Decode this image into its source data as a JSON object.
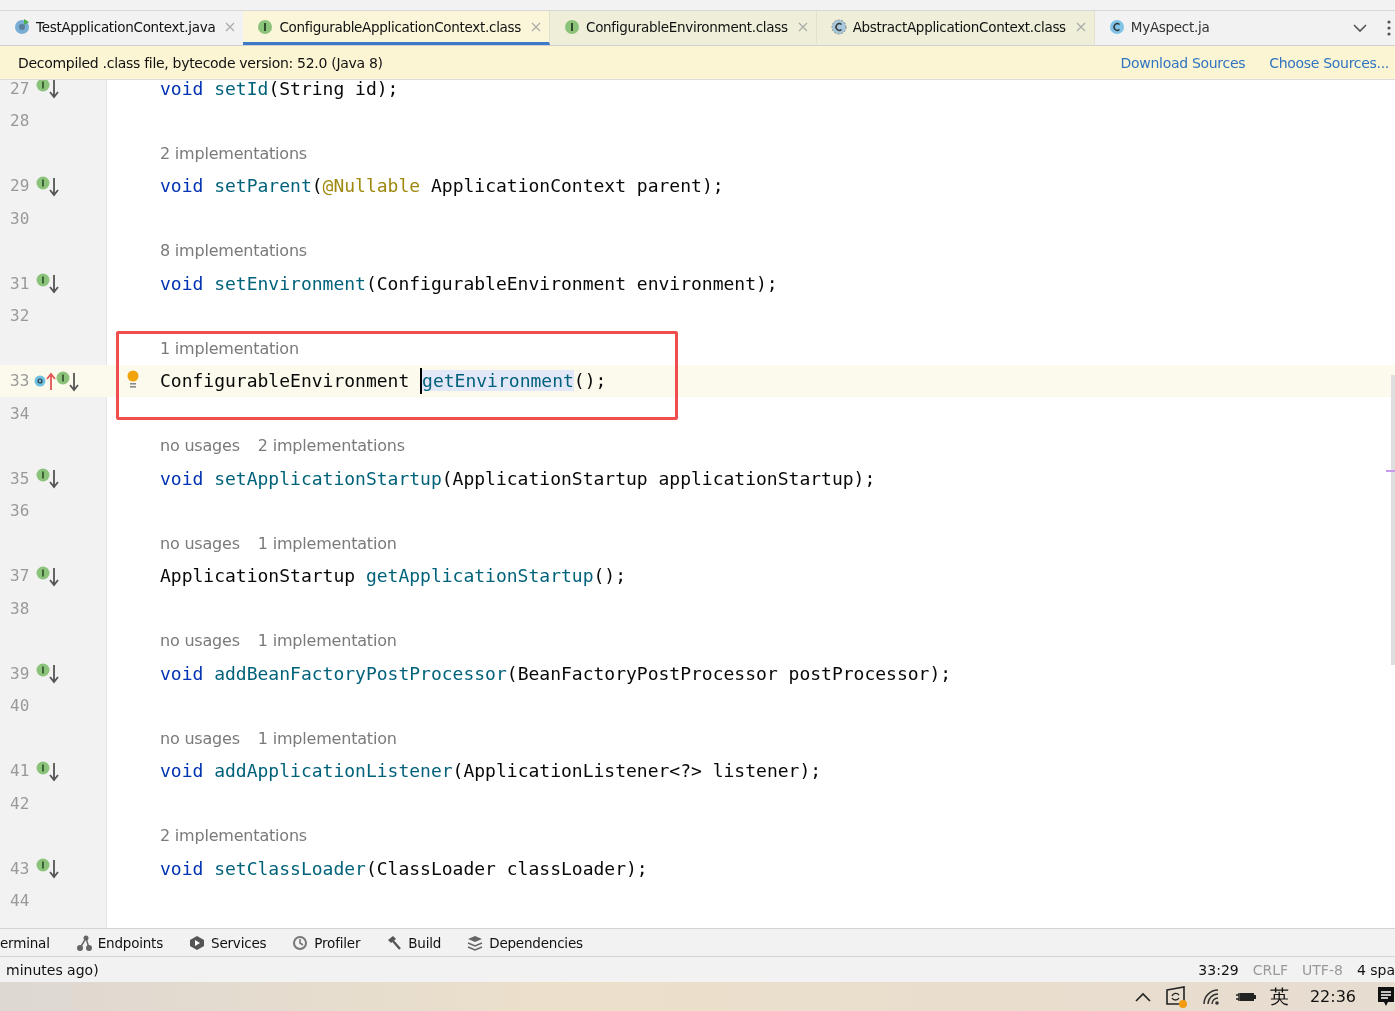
{
  "tabs": [
    {
      "label": "TestApplicationContext.java",
      "kind": "test",
      "selected": false
    },
    {
      "label": "ConfigurableApplicationContext.class",
      "kind": "interface",
      "selected": true
    },
    {
      "label": "ConfigurableEnvironment.class",
      "kind": "interface",
      "selected": false
    },
    {
      "label": "AbstractApplicationContext.class",
      "kind": "abstract",
      "selected": false
    },
    {
      "label": "MyAspect.ja",
      "kind": "class",
      "selected": false
    }
  ],
  "banner": {
    "message": "Decompiled .class file, bytecode version: 52.0 (Java 8)",
    "links": [
      "Download Sources",
      "Choose Sources..."
    ]
  },
  "editor": {
    "rows": [
      {
        "kind": "code",
        "number": "27",
        "markers": [
          {
            "kind": "implemented"
          }
        ],
        "current": false,
        "bulb": false,
        "tokens": [
          {
            "t": "void ",
            "kind": "keyword"
          },
          {
            "t": "setId",
            "kind": "method"
          },
          {
            "t": "(String id);"
          }
        ]
      },
      {
        "kind": "blank",
        "number": "28"
      },
      {
        "kind": "hint",
        "hints": [
          "2 implementations"
        ]
      },
      {
        "kind": "code",
        "number": "29",
        "markers": [
          {
            "kind": "implemented"
          }
        ],
        "current": false,
        "bulb": false,
        "tokens": [
          {
            "t": "void ",
            "kind": "keyword"
          },
          {
            "t": "setParent",
            "kind": "method"
          },
          {
            "t": "("
          },
          {
            "t": "@Nullable",
            "kind": "annotation"
          },
          {
            "t": " ApplicationContext parent);"
          }
        ]
      },
      {
        "kind": "blank",
        "number": "30"
      },
      {
        "kind": "hint",
        "hints": [
          "8 implementations"
        ]
      },
      {
        "kind": "code",
        "number": "31",
        "markers": [
          {
            "kind": "implemented"
          }
        ],
        "current": false,
        "bulb": false,
        "tokens": [
          {
            "t": "void ",
            "kind": "keyword"
          },
          {
            "t": "setEnvironment",
            "kind": "method"
          },
          {
            "t": "(ConfigurableEnvironment environment);"
          }
        ]
      },
      {
        "kind": "blank",
        "number": "32"
      },
      {
        "kind": "hint",
        "hints": [
          "1 implementation"
        ]
      },
      {
        "kind": "code",
        "number": "33",
        "markers": [
          {
            "kind": "overrides"
          },
          {
            "kind": "implemented"
          }
        ],
        "current": true,
        "bulb": true,
        "tokens": [
          {
            "t": "ConfigurableEnvironment "
          },
          {
            "t": "getEnvironment",
            "kind": "method",
            "selected": true
          },
          {
            "t": "();"
          }
        ]
      },
      {
        "kind": "blank",
        "number": "34"
      },
      {
        "kind": "hint",
        "hints": [
          "no usages",
          "2 implementations"
        ]
      },
      {
        "kind": "code",
        "number": "35",
        "markers": [
          {
            "kind": "implemented"
          }
        ],
        "current": false,
        "bulb": false,
        "tokens": [
          {
            "t": "void ",
            "kind": "keyword"
          },
          {
            "t": "setApplicationStartup",
            "kind": "method"
          },
          {
            "t": "(ApplicationStartup applicationStartup);"
          }
        ]
      },
      {
        "kind": "blank",
        "number": "36"
      },
      {
        "kind": "hint",
        "hints": [
          "no usages",
          "1 implementation"
        ]
      },
      {
        "kind": "code",
        "number": "37",
        "markers": [
          {
            "kind": "implemented"
          }
        ],
        "current": false,
        "bulb": false,
        "tokens": [
          {
            "t": "ApplicationStartup "
          },
          {
            "t": "getApplicationStartup",
            "kind": "method"
          },
          {
            "t": "();"
          }
        ]
      },
      {
        "kind": "blank",
        "number": "38"
      },
      {
        "kind": "hint",
        "hints": [
          "no usages",
          "1 implementation"
        ]
      },
      {
        "kind": "code",
        "number": "39",
        "markers": [
          {
            "kind": "implemented"
          }
        ],
        "current": false,
        "bulb": false,
        "tokens": [
          {
            "t": "void ",
            "kind": "keyword"
          },
          {
            "t": "addBeanFactoryPostProcessor",
            "kind": "method"
          },
          {
            "t": "(BeanFactoryPostProcessor postProcessor);"
          }
        ]
      },
      {
        "kind": "blank",
        "number": "40"
      },
      {
        "kind": "hint",
        "hints": [
          "no usages",
          "1 implementation"
        ]
      },
      {
        "kind": "code",
        "number": "41",
        "markers": [
          {
            "kind": "implemented"
          }
        ],
        "current": false,
        "bulb": false,
        "tokens": [
          {
            "t": "void ",
            "kind": "keyword"
          },
          {
            "t": "addApplicationListener",
            "kind": "method"
          },
          {
            "t": "(ApplicationListener<?> listener);"
          }
        ]
      },
      {
        "kind": "blank",
        "number": "42"
      },
      {
        "kind": "hint",
        "hints": [
          "2 implementations"
        ]
      },
      {
        "kind": "code",
        "number": "43",
        "markers": [
          {
            "kind": "implemented"
          }
        ],
        "current": false,
        "bulb": false,
        "tokens": [
          {
            "t": "void ",
            "kind": "keyword"
          },
          {
            "t": "setClassLoader",
            "kind": "method"
          },
          {
            "t": "(ClassLoader classLoader);"
          }
        ]
      },
      {
        "kind": "blank",
        "number": "44"
      }
    ]
  },
  "tool_windows": [
    {
      "label": "erminal",
      "kind": "plain"
    },
    {
      "label": "Endpoints",
      "kind": "endpoints"
    },
    {
      "label": "Services",
      "kind": "services"
    },
    {
      "label": "Profiler",
      "kind": "profiler"
    },
    {
      "label": "Build",
      "kind": "build"
    },
    {
      "label": "Dependencies",
      "kind": "dependencies"
    }
  ],
  "status_bar": {
    "message": "minutes ago)",
    "items": [
      {
        "text": "33:29",
        "kind": "strong"
      },
      {
        "text": "CRLF",
        "kind": "muted"
      },
      {
        "text": "UTF-8",
        "kind": "muted"
      },
      {
        "text": "4 spa",
        "kind": "strong"
      }
    ]
  },
  "taskbar": {
    "input_method": "英",
    "time": "22:36"
  }
}
